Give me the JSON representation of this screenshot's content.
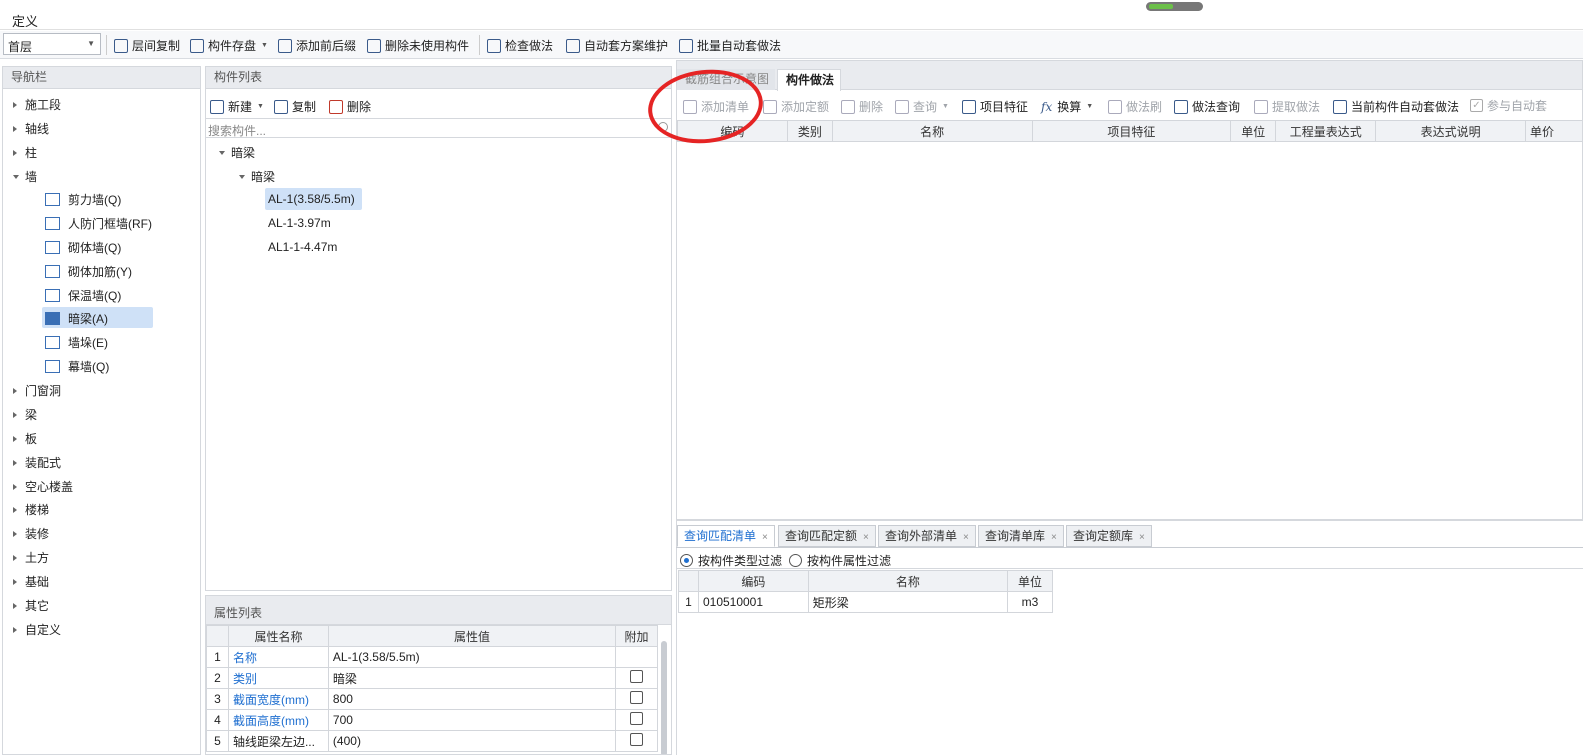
{
  "title": "定义",
  "floor_select": "首层",
  "toolbar": {
    "items": [
      "层间复制",
      "构件存盘",
      "添加前后缀",
      "删除未使用构件",
      "检查做法",
      "自动套方案维护",
      "批量自动套做法"
    ]
  },
  "nav": {
    "header": "导航栏",
    "items": [
      "施工段",
      "轴线",
      "柱",
      "墙",
      "门窗洞",
      "梁",
      "板",
      "装配式",
      "空心楼盖",
      "楼梯",
      "装修",
      "土方",
      "基础",
      "其它",
      "自定义"
    ],
    "wall_children": [
      "剪力墙(Q)",
      "人防门框墙(RF)",
      "砌体墙(Q)",
      "砌体加筋(Y)",
      "保温墙(Q)",
      "暗梁(A)",
      "墙垛(E)",
      "幕墙(Q)"
    ]
  },
  "comp_list": {
    "header": "构件列表",
    "new_label": "新建",
    "copy_label": "复制",
    "delete_label": "删除",
    "search_placeholder": "搜索构件...",
    "group1": "暗梁",
    "group2": "暗梁",
    "items": [
      "AL-1(3.58/5.5m)",
      "AL-1-3.97m",
      "AL1-1-4.47m"
    ]
  },
  "props": {
    "header": "属性列表",
    "cols": [
      "属性名称",
      "属性值",
      "附加"
    ],
    "rows": [
      {
        "no": "1",
        "name": "名称",
        "value": "AL-1(3.58/5.5m)"
      },
      {
        "no": "2",
        "name": "类别",
        "value": "暗梁"
      },
      {
        "no": "3",
        "name": "截面宽度(mm)",
        "value": "800"
      },
      {
        "no": "4",
        "name": "截面高度(mm)",
        "value": "700"
      },
      {
        "no": "5",
        "name": "轴线距梁左边...",
        "value": "(400)"
      }
    ]
  },
  "right": {
    "tabs": [
      "截筋组合示意图",
      "构件做法"
    ],
    "toolbar": [
      "添加清单",
      "添加定额",
      "删除",
      "查询",
      "项目特征",
      "换算",
      "做法刷",
      "做法查询",
      "提取做法",
      "当前构件自动套做法",
      "参与自动套"
    ],
    "cols": [
      "编码",
      "类别",
      "名称",
      "项目特征",
      "单位",
      "工程量表达式",
      "表达式说明",
      "单价"
    ]
  },
  "bottom": {
    "tabs": [
      "查询匹配清单",
      "查询匹配定额",
      "查询外部清单",
      "查询清单库",
      "查询定额库"
    ],
    "filter1": "按构件类型过滤",
    "filter2": "按构件属性过滤",
    "cols": [
      "编码",
      "名称",
      "单位"
    ],
    "rows": [
      {
        "no": "1",
        "code": "010510001",
        "name": "矩形梁",
        "unit": "m3"
      }
    ]
  }
}
